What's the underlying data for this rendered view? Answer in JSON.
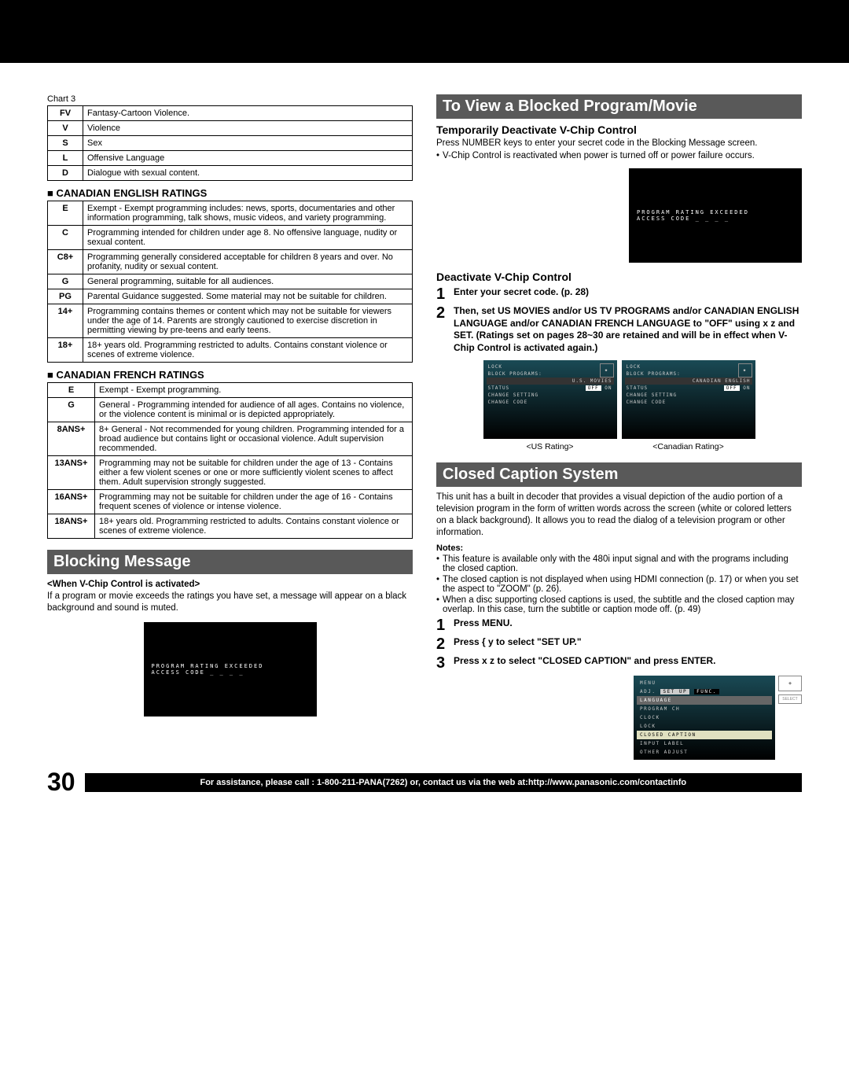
{
  "chart3_label": "Chart 3",
  "chart3": [
    {
      "k": "FV",
      "v": "Fantasy-Cartoon Violence."
    },
    {
      "k": "V",
      "v": "Violence"
    },
    {
      "k": "S",
      "v": "Sex"
    },
    {
      "k": "L",
      "v": "Offensive Language"
    },
    {
      "k": "D",
      "v": "Dialogue with sexual content."
    }
  ],
  "can_en_title": "CANADIAN ENGLISH RATINGS",
  "can_en": [
    {
      "k": "E",
      "v": "Exempt - Exempt programming includes: news, sports, documentaries and other information programming, talk shows, music videos, and variety programming."
    },
    {
      "k": "C",
      "v": "Programming intended for children under age 8. No offensive language, nudity or sexual content."
    },
    {
      "k": "C8+",
      "v": "Programming generally considered acceptable for children 8 years and over. No profanity, nudity or sexual content."
    },
    {
      "k": "G",
      "v": "General programming, suitable for all audiences."
    },
    {
      "k": "PG",
      "v": "Parental Guidance suggested. Some material may not be suitable for children."
    },
    {
      "k": "14+",
      "v": "Programming contains themes or content which may not be suitable for viewers under the age of 14. Parents are strongly cautioned to exercise discretion in permitting viewing by pre-teens and early teens."
    },
    {
      "k": "18+",
      "v": "18+ years old. Programming restricted to adults. Contains constant violence or scenes of extreme violence."
    }
  ],
  "can_fr_title": "CANADIAN FRENCH RATINGS",
  "can_fr": [
    {
      "k": "E",
      "v": "Exempt - Exempt programming."
    },
    {
      "k": "G",
      "v": "General - Programming intended for audience of all ages. Contains no violence, or the violence content is minimal or is depicted appropriately."
    },
    {
      "k": "8ANS+",
      "v": "8+ General - Not recommended for young children. Programming intended for a broad audience but contains light or occasional violence. Adult supervision recommended."
    },
    {
      "k": "13ANS+",
      "v": "Programming may not be suitable for children under the age of 13 - Contains either a few violent scenes or one or more sufficiently violent scenes to affect them. Adult supervision strongly suggested."
    },
    {
      "k": "16ANS+",
      "v": "Programming may not be suitable for children under the age of 16 - Contains frequent scenes of violence or intense violence."
    },
    {
      "k": "18ANS+",
      "v": "18+ years old. Programming restricted to adults. Contains constant violence or scenes of extreme violence."
    }
  ],
  "blocking": {
    "band": "Blocking Message",
    "when_label": "<When V-Chip Control is activated>",
    "text": "If a program or movie exceeds the ratings you have set, a message will appear on a black background and sound is muted.",
    "osd_line1": "PROGRAM RATING EXCEEDED",
    "osd_line2": "ACCESS CODE _ _ _ _"
  },
  "toview": {
    "band": "To View a Blocked Program/Movie",
    "sub1": "Temporarily Deactivate V-Chip Control",
    "p1": "Press NUMBER keys to enter your secret code in the Blocking Message screen.",
    "bullet1": "V-Chip Control is reactivated when power is turned off or power failure occurs.",
    "sub2": "Deactivate V-Chip Control",
    "step1": "Enter your secret code. (p. 28)",
    "step2": "Then, set US MOVIES and/or US TV PROGRAMS and/or CANADIAN ENGLISH LANGUAGE and/or CANADIAN FRENCH LANGUAGE to \"OFF\" using x z and SET. (Ratings set on pages 28~30 are retained and will be in effect when V-Chip Control is activated again.)",
    "osd_us_label": "<US Rating>",
    "osd_ca_label": "<Canadian Rating>",
    "osd_title": "LOCK",
    "osd_block": "BLOCK PROGRAMS:",
    "osd_us_movies": "U.S. MOVIES",
    "osd_can_en": "CANADIAN ENGLISH",
    "osd_status": "STATUS",
    "osd_off": "OFF",
    "osd_on": "ON",
    "osd_change_setting": "CHANGE SETTING",
    "osd_change_code": "CHANGE CODE"
  },
  "cc": {
    "band": "Closed Caption System",
    "intro": "This unit has a built in decoder that provides a visual depiction of the audio portion of a television program in the form of written words across the screen (white or colored letters on a black background). It allows you to read the dialog of a television program or other information.",
    "notes_label": "Notes:",
    "note1": "This feature is available only with the 480i input signal and with the programs including the closed caption.",
    "note2": "The closed caption is not displayed when using HDMI connection (p. 17) or when you set the aspect to \"ZOOM\" (p. 26).",
    "note3": "When a disc supporting closed captions is used, the subtitle and the closed caption may overlap. In this case, turn the subtitle or caption mode off. (p. 49)",
    "step1": "Press MENU.",
    "step2": "Press { y  to select \"SET UP.\"",
    "step3": "Press x z  to select \"CLOSED CAPTION\" and press ENTER.",
    "menu_title": "MENU",
    "menu_tabs": [
      "ADJ.",
      "SET UP",
      "FUNC."
    ],
    "menu_items": [
      "LANGUAGE",
      "PROGRAM CH",
      "CLOCK",
      "LOCK",
      "CLOSED CAPTION",
      "INPUT LABEL",
      "OTHER ADJUST"
    ]
  },
  "footer": {
    "page": "30",
    "text": "For assistance, please call : 1-800-211-PANA(7262) or, contact us via the web at:http://www.panasonic.com/contactinfo"
  }
}
